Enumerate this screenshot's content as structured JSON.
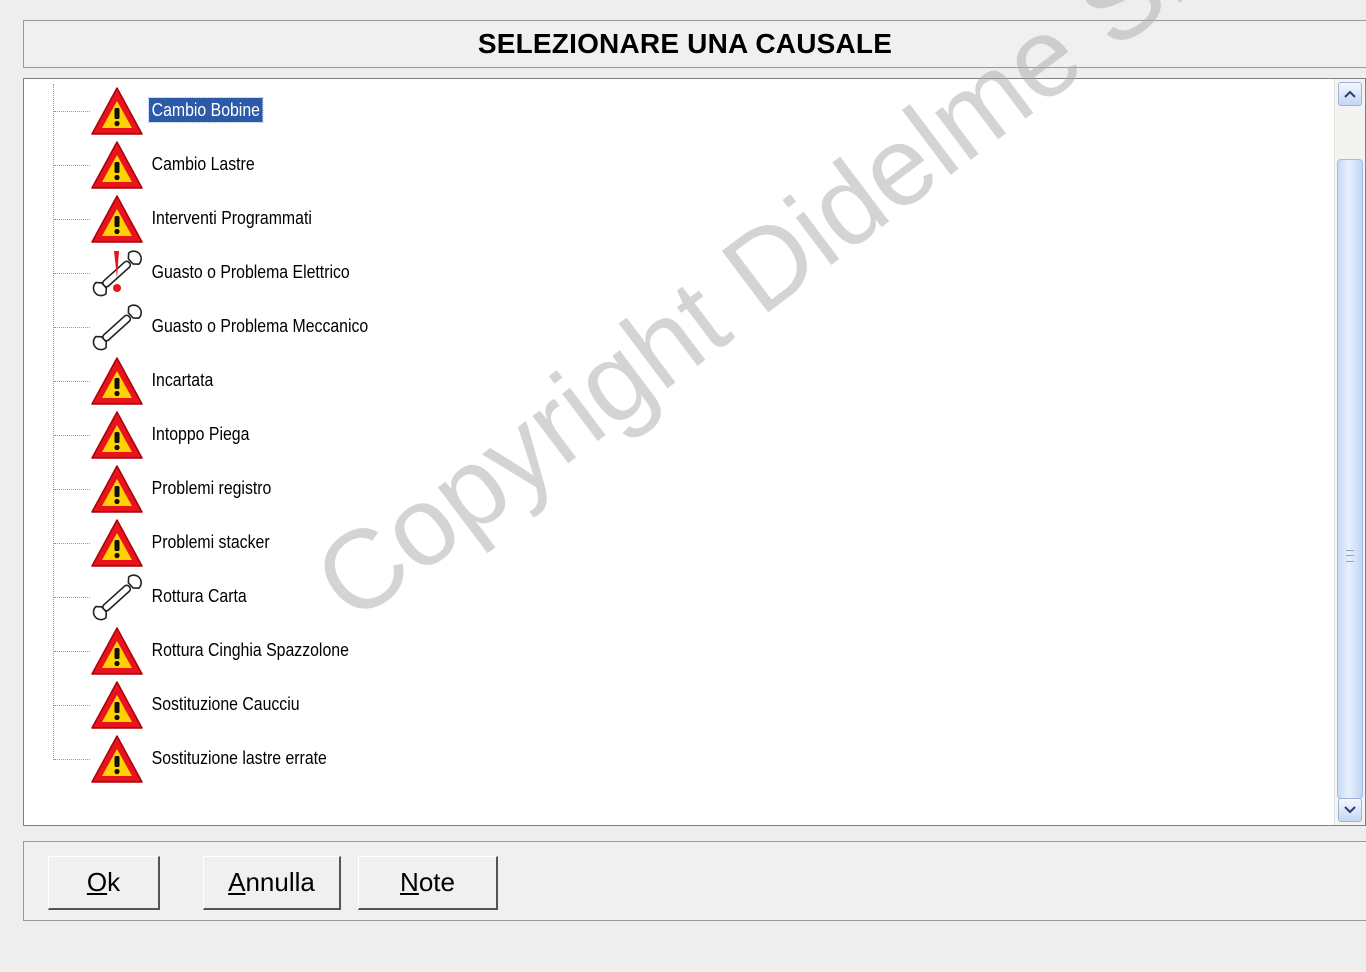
{
  "title": "SELEZIONARE UNA CAUSALE",
  "items": [
    {
      "label": "Cambio Bobine",
      "icon": "warning-icon",
      "selected": true
    },
    {
      "label": "Cambio Lastre",
      "icon": "warning-icon",
      "selected": false
    },
    {
      "label": "Interventi Programmati",
      "icon": "warning-icon",
      "selected": false
    },
    {
      "label": "Guasto o Problema Elettrico",
      "icon": "electric-wrench-icon",
      "selected": false
    },
    {
      "label": "Guasto o Problema Meccanico",
      "icon": "wrench-icon",
      "selected": false
    },
    {
      "label": "Incartata",
      "icon": "warning-icon",
      "selected": false
    },
    {
      "label": "Intoppo Piega",
      "icon": "warning-icon",
      "selected": false
    },
    {
      "label": "Problemi registro",
      "icon": "warning-icon",
      "selected": false
    },
    {
      "label": "Problemi stacker",
      "icon": "warning-icon",
      "selected": false
    },
    {
      "label": "Rottura Carta",
      "icon": "wrench-icon",
      "selected": false
    },
    {
      "label": "Rottura Cinghia Spazzolone",
      "icon": "warning-icon",
      "selected": false
    },
    {
      "label": "Sostituzione Caucciu",
      "icon": "warning-icon",
      "selected": false
    },
    {
      "label": "Sostituzione lastre errate",
      "icon": "warning-icon",
      "selected": false
    }
  ],
  "buttons": {
    "ok": {
      "mnemonic": "O",
      "rest": "k"
    },
    "annulla": {
      "mnemonic": "A",
      "rest": "nnulla"
    },
    "note": {
      "mnemonic": "N",
      "rest": "ote"
    }
  },
  "watermark": "Copyright Didelme Sistemi",
  "colors": {
    "selection": "#2d5aa8",
    "warning_red": "#e8141c",
    "warning_yellow": "#ffd200"
  }
}
